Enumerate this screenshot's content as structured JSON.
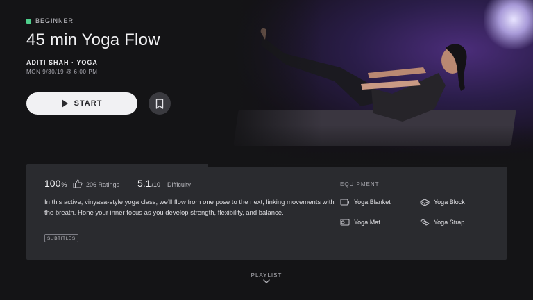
{
  "class": {
    "level": "BEGINNER",
    "level_color": "#4fcf8c",
    "title": "45 min Yoga Flow",
    "instructor_line": "ADITI SHAH · YOGA",
    "datetime": "MON 9/30/19 @ 6:00 PM"
  },
  "actions": {
    "start_label": "START",
    "start_icon": "play-icon",
    "bookmark_icon": "bookmark-icon"
  },
  "stats": {
    "rating_value": "100",
    "rating_unit": "%",
    "rating_icon": "thumbs-up-icon",
    "ratings_count": "206 Ratings",
    "difficulty_value": "5.1",
    "difficulty_of": "/10",
    "difficulty_label": "Difficulty"
  },
  "description": "In this active, vinyasa-style yoga class, we’ll flow from one pose to the next, linking movements with the breath. Hone your inner focus as you develop strength, flexibility, and balance.",
  "subtitles_badge": "SUBTITLES",
  "equipment": {
    "heading": "EQUIPMENT",
    "items": [
      {
        "label": "Yoga Blanket",
        "icon": "blanket-icon"
      },
      {
        "label": "Yoga Block",
        "icon": "block-icon"
      },
      {
        "label": "Yoga Mat",
        "icon": "mat-icon"
      },
      {
        "label": "Yoga Strap",
        "icon": "strap-icon"
      }
    ]
  },
  "playlist": {
    "label": "PLAYLIST",
    "icon": "chevron-down-icon"
  }
}
